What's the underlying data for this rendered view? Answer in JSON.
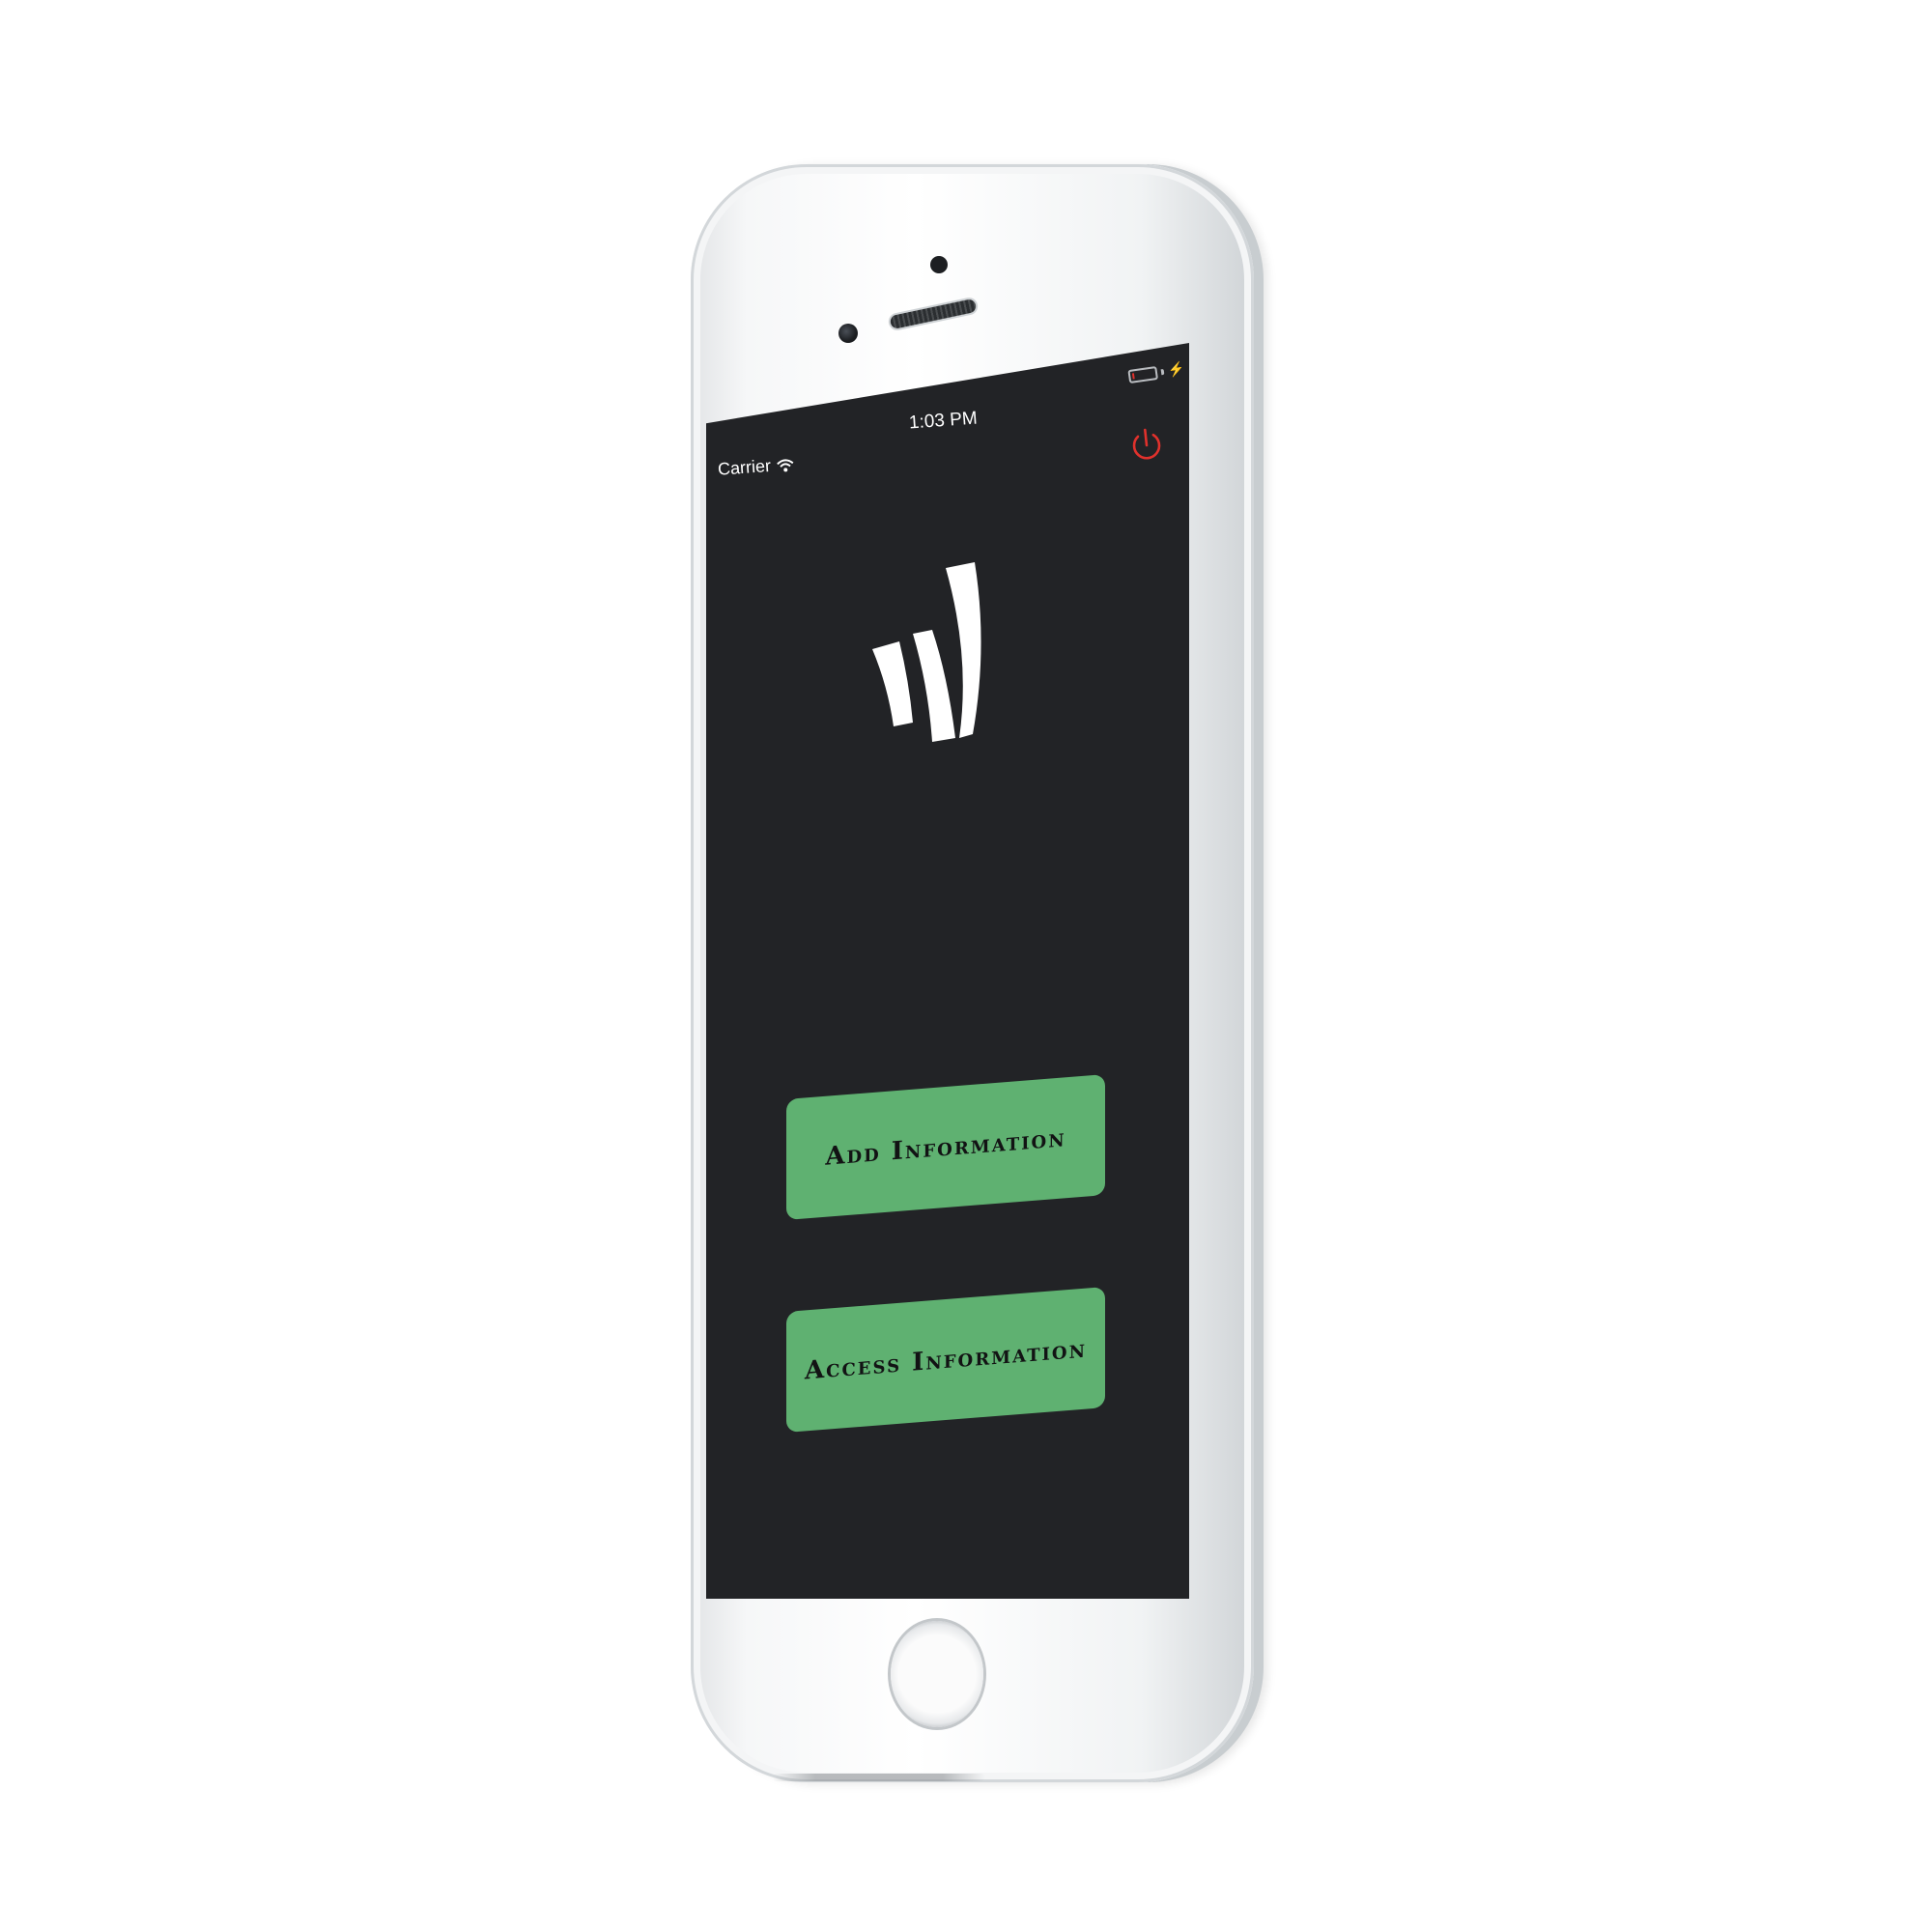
{
  "status_bar": {
    "carrier": "Carrier",
    "time": "1:03 PM",
    "battery_level": 0.1,
    "battery_color": "#e0312c",
    "charging_icon": "bolt-icon",
    "wifi_icon": "wifi-icon"
  },
  "header": {
    "power_icon": "power-icon",
    "power_icon_color": "#e0312c"
  },
  "logo": {
    "icon": "app-logo",
    "color": "#ffffff"
  },
  "buttons": {
    "add_label": "Add Information",
    "access_label": "Access Information",
    "color": "#5fb171"
  },
  "theme": {
    "screen_background": "#222326",
    "device_color": "#f4f5f6"
  }
}
